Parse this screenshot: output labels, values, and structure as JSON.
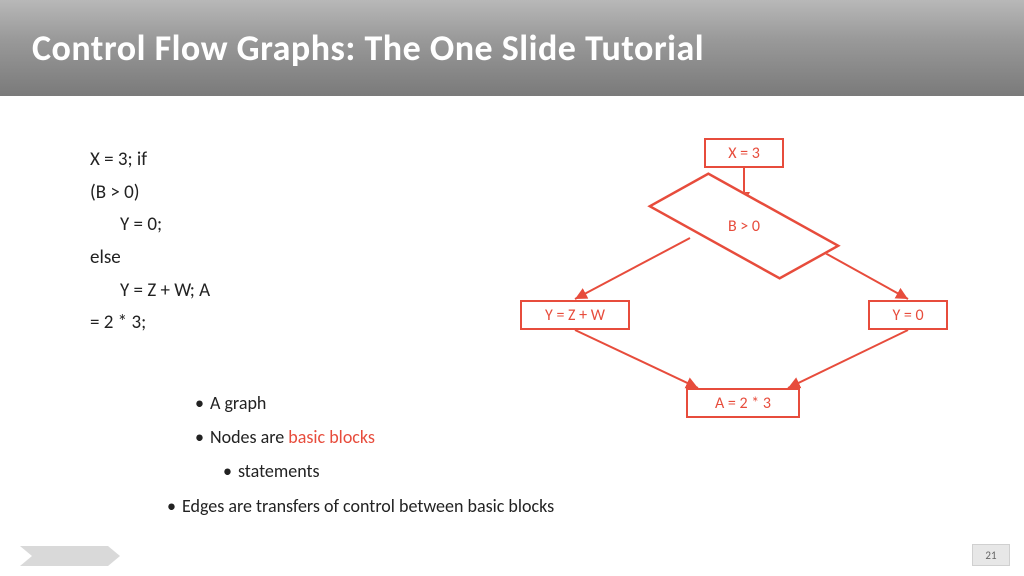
{
  "title": "Control Flow Graphs: The One  Slide Tutorial",
  "code": {
    "l1": "X = 3;  if",
    "l2": "(B > 0)",
    "l3": "Y = 0;",
    "l4": "else",
    "l5": "Y = Z + W;  A",
    "l6": "= 2 * 3;"
  },
  "bullets": {
    "b1": "A graph",
    "b2_pre": "Nodes are ",
    "b2_hl": "basic blocks",
    "b3": "statements",
    "b4": "Edges are transfers of control between basic blocks"
  },
  "flow": {
    "n1": "X = 3",
    "cond": "B > 0",
    "left": "Y = Z + W",
    "right": "Y = 0",
    "merge": "A = 2 * 3"
  },
  "page_number": "21"
}
